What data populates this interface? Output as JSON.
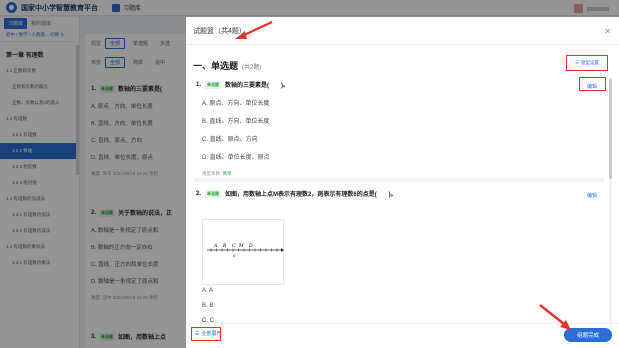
{
  "topbar": {
    "platform_name": "国家中小学智慧教育平台",
    "tab_label": "习题库"
  },
  "sidebar": {
    "tabs": [
      "习题库",
      "我的题库"
    ],
    "path": "初中 / 数学 / 人教版... 切换 ⇅",
    "chapter": "第一章 有理数",
    "items": [
      {
        "label": "1.1 正数和负数",
        "sub": false,
        "active": false
      },
      {
        "label": "正数和负数的概念",
        "sub": true,
        "active": false
      },
      {
        "label": "正数、负数以及0的意义",
        "sub": true,
        "active": false
      },
      {
        "label": "1.2 有理数",
        "sub": false,
        "active": false
      },
      {
        "label": "1.2.1 有理数",
        "sub": true,
        "active": false
      },
      {
        "label": "1.2.2 数轴",
        "sub": true,
        "active": true
      },
      {
        "label": "1.2.3 相反数",
        "sub": true,
        "active": false
      },
      {
        "label": "1.2.4 绝对值",
        "sub": true,
        "active": false
      },
      {
        "label": "1.3 有理数的加减法",
        "sub": false,
        "active": false
      },
      {
        "label": "1.3.1 有理数的加法",
        "sub": true,
        "active": false
      },
      {
        "label": "1.3.2 有理数的减法",
        "sub": true,
        "active": false
      },
      {
        "label": "1.4 有理数的乘除法",
        "sub": false,
        "active": false
      },
      {
        "label": "1.4.1 有理数的乘法",
        "sub": true,
        "active": false
      }
    ]
  },
  "middle": {
    "filter_label1": "题型",
    "filter_chips1": [
      "全部",
      "单选题",
      "多选"
    ],
    "filter_label2": "难度",
    "filter_chips2": [
      "全部",
      "简单",
      "适中"
    ],
    "questions": [
      {
        "num": "1.",
        "tag": "单选题",
        "title": "数轴的三要素是(",
        "options": [
          "A. 原点、方向、单位长度",
          "B. 直线、方向、单位长度",
          "C. 直线、原点、方向",
          "D. 直线、单位长度、原点"
        ],
        "meta": "难度: 简单   2021/06/18 19:28 更新"
      },
      {
        "num": "2.",
        "tag": "单选题",
        "title": "关于数轴的说法，正",
        "options": [
          "A. 数轴是一条规定了原点和",
          "B. 数轴的正方向一定向右",
          "C. 直线、正方向和单位长度",
          "D. 数轴是一条规定了原点和"
        ],
        "meta": "难度: 适中   2021/06/18 19:28 更新"
      },
      {
        "num": "3.",
        "tag": "单选题",
        "title": "如图，用数轴上点",
        "options": [],
        "meta": ""
      }
    ]
  },
  "drawer": {
    "title": "试题篮（共4题）",
    "section_title": "一、单选题",
    "section_count": "(共2题)",
    "analysis_label": "题型设置",
    "edit_label": "编辑",
    "q1": {
      "num": "1.",
      "tag": "单选题",
      "title": "数轴的三要素是(　　)。",
      "options": [
        "A. 原点、方向、单位长度",
        "B. 直线、方向、单位长度",
        "C. 直线、原点、方向",
        "D. 直线、单位长度、原点"
      ],
      "meta_label": "难度系数:",
      "meta_value": "简单"
    },
    "q2": {
      "num": "2.",
      "tag": "单选题",
      "title": "如图，用数轴上点M表示有理数2，则表示有理数6的点是(　　)。",
      "numline_labels": [
        "A",
        "B",
        "C",
        "M",
        "D",
        "0"
      ],
      "options": [
        "A. A",
        "B. B",
        "C. C"
      ]
    },
    "collapse_label": "全部展开",
    "submit_label": "组题完成"
  },
  "colors": {
    "accent": "#2b6fd6",
    "annotation": "#e5322d",
    "easy_tag": "#3aa24b"
  }
}
